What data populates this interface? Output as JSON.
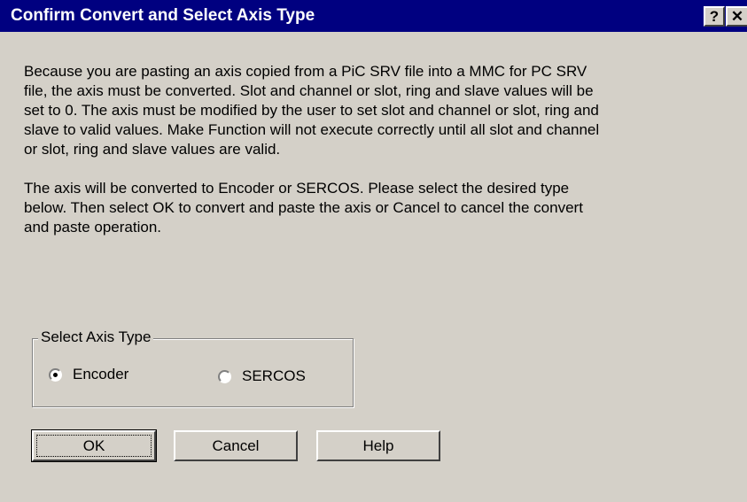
{
  "window": {
    "title": "Confirm Convert and Select Axis Type",
    "help_glyph": "?",
    "close_glyph": "✕"
  },
  "message": {
    "paragraph1": " Because you are pasting an axis copied from a PiC SRV file into a MMC for PC SRV\nfile, the axis must be converted.  Slot and channel or slot, ring and slave values will be\nset to 0.  The axis must be modified by the user to set slot and channel or slot, ring and\nslave to valid values.  Make Function will not execute correctly until all slot and channel\nor slot, ring and slave values are valid.",
    "paragraph2": "The axis will be converted to Encoder or SERCOS.  Please select the desired type\nbelow.  Then select OK to convert and paste the axis or Cancel to cancel the convert\nand paste operation."
  },
  "axis_type_group": {
    "label": "Select Axis Type",
    "options": [
      {
        "label": "Encoder",
        "selected": true
      },
      {
        "label": "SERCOS",
        "selected": false
      }
    ]
  },
  "buttons": {
    "ok": "OK",
    "cancel": "Cancel",
    "help": "Help"
  },
  "colors": {
    "titlebar": "#000080",
    "face": "#d4d0c8"
  }
}
